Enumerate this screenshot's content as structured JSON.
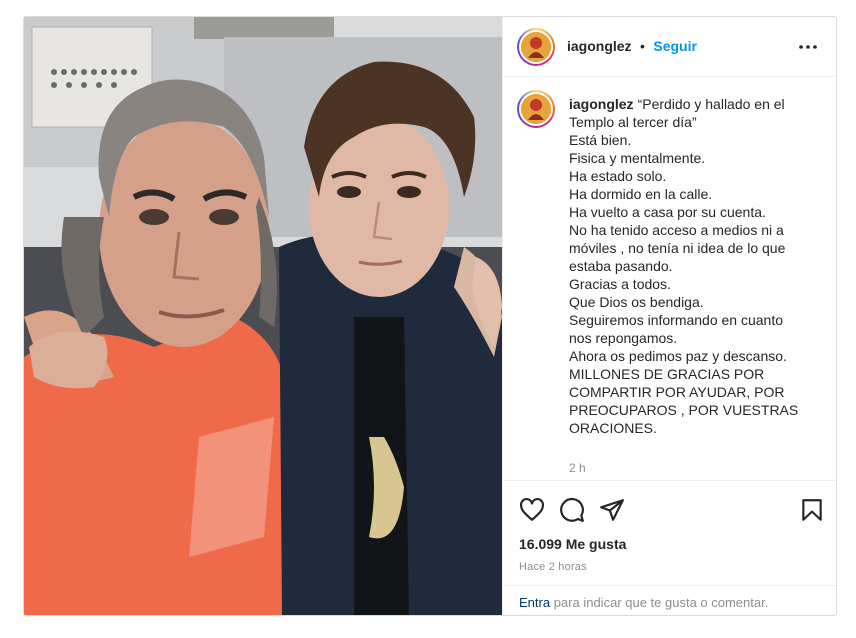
{
  "post": {
    "author": {
      "username": "iagonglez",
      "avatar_icon": "user-avatar"
    },
    "separator": "•",
    "follow_label": "Seguir",
    "more_icon": "more-horizontal-icon",
    "caption": {
      "username": "iagonglez",
      "text": "“Perdido y hallado en el Templo al tercer día”\nEstá bien.\nFisica y mentalmente.\nHa estado solo.\nHa dormido en la calle.\nHa vuelto a casa por su cuenta.\nNo ha tenido acceso a medios ni a móviles , no tenía ni idea de lo que estaba pasando.\nGracias a todos.\nQue Dios os bendiga.\nSeguiremos informando en cuanto nos repongamos.\nAhora os pedimos paz y descanso.\nMILLONES DE GRACIAS POR COMPARTIR POR AYUDAR, POR PREOCUPAROS , POR VUESTRAS ORACIONES.",
      "time": "2 h"
    },
    "actions": {
      "like_icon": "heart-icon",
      "comment_icon": "comment-icon",
      "share_icon": "send-icon",
      "save_icon": "bookmark-icon"
    },
    "likes_text": "16.099 Me gusta",
    "time_ago": "Hace 2 horas",
    "login_prompt": {
      "link": "Entra",
      "text": "para indicar que te gusta o comentar."
    },
    "colors": {
      "follow": "#0095f6",
      "muted": "#8e8e8e",
      "border": "#dbdbdb",
      "link": "#00376b"
    }
  }
}
